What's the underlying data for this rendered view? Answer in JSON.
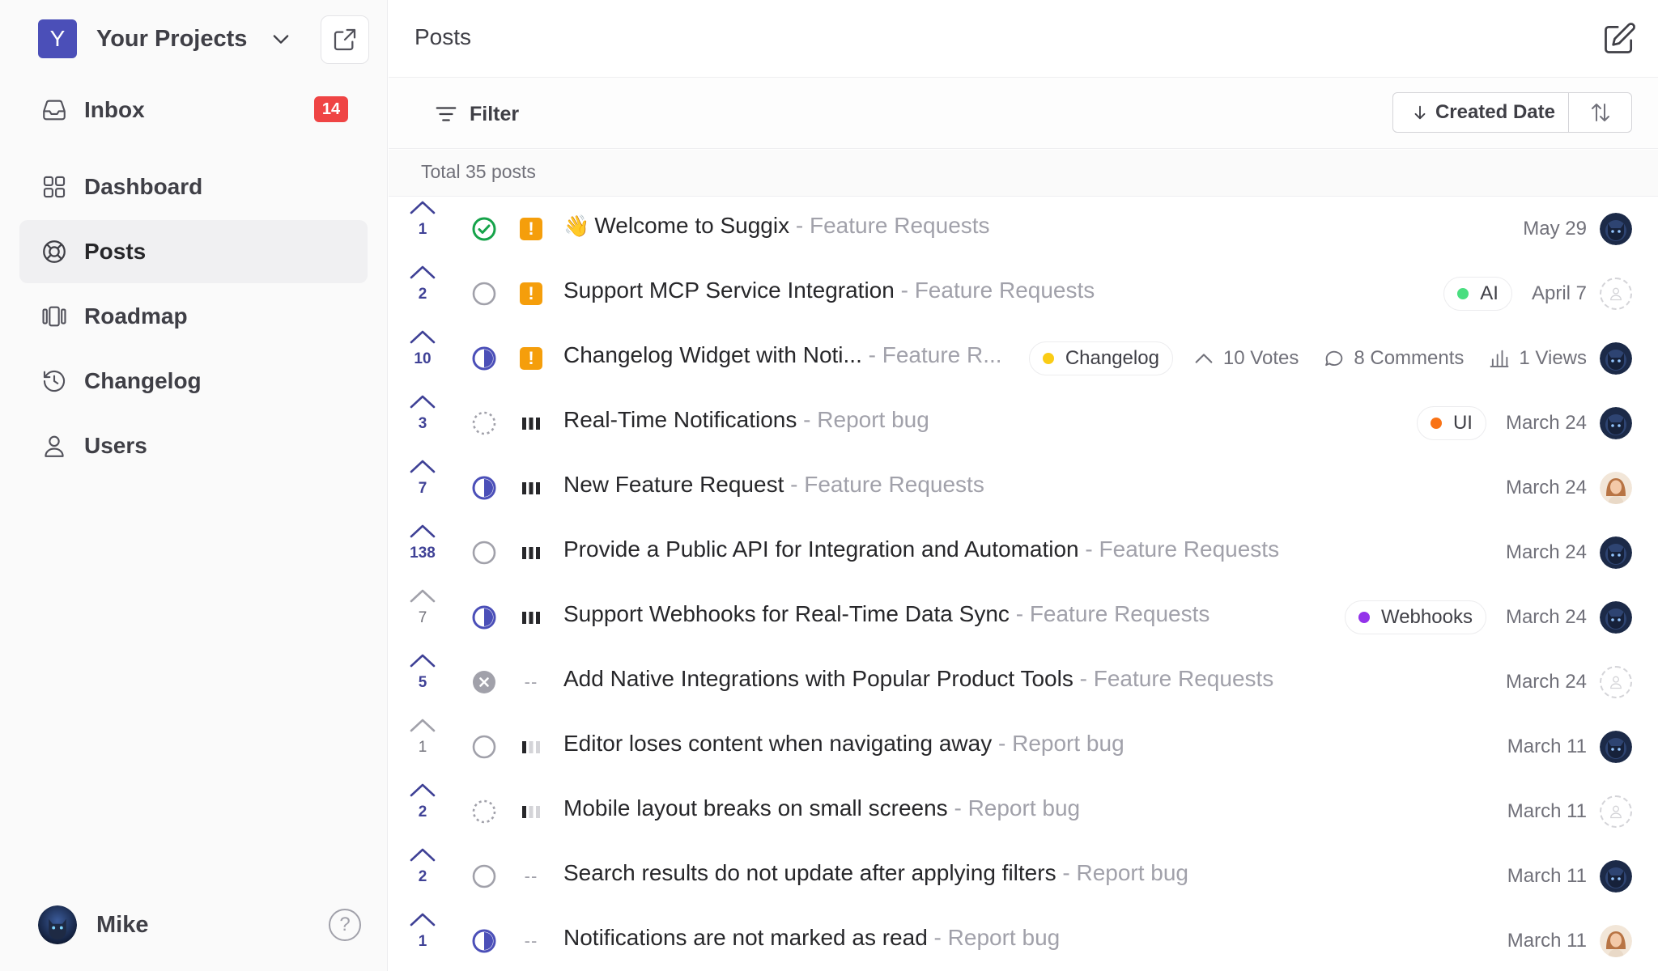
{
  "colors": {
    "brand": "#4b4fb8",
    "vote_active": "#3f4196",
    "badge": "#ef4444",
    "urgent": "#f59e0b",
    "done": "#16a34a"
  },
  "project": {
    "initial": "Y",
    "name": "Your Projects"
  },
  "nav": [
    {
      "label": "Inbox",
      "icon": "inbox-icon",
      "badge": "14"
    },
    {
      "label": "Dashboard",
      "icon": "dashboard-icon"
    },
    {
      "label": "Posts",
      "icon": "posts-icon",
      "active": true
    },
    {
      "label": "Roadmap",
      "icon": "roadmap-icon"
    },
    {
      "label": "Changelog",
      "icon": "changelog-icon"
    },
    {
      "label": "Users",
      "icon": "users-icon"
    }
  ],
  "user": {
    "name": "Mike",
    "help": "?"
  },
  "header": {
    "title": "Posts"
  },
  "toolbar": {
    "filter_label": "Filter",
    "sort_label": "Created Date"
  },
  "list": {
    "total": "Total 35 posts"
  },
  "posts": [
    {
      "votes": "1",
      "voted": true,
      "status": "complete",
      "priority": "urgent",
      "emoji": "👋",
      "title": "Welcome to Suggix",
      "board": "Feature Requests",
      "tags": [],
      "date": "May 29",
      "assignee": "cat-avatar"
    },
    {
      "votes": "2",
      "voted": true,
      "status": "open",
      "priority": "urgent",
      "title": "Support MCP Service Integration",
      "board": "Feature Requests",
      "tags": [
        {
          "name": "AI",
          "color": "#4ade80"
        }
      ],
      "date": "April 7",
      "assignee": "unassigned"
    },
    {
      "votes": "10",
      "voted": true,
      "status": "in-progress",
      "priority": "urgent",
      "title": "Changelog Widget with Noti...",
      "board": "Feature R...",
      "tags": [
        {
          "name": "Changelog",
          "color": "#facc15"
        }
      ],
      "stats": {
        "votes": "10 Votes",
        "comments": "8 Comments",
        "views": "1 Views"
      },
      "date": "",
      "assignee": "cat-avatar"
    },
    {
      "votes": "3",
      "voted": true,
      "status": "planned",
      "priority": "high",
      "title": "Real-Time Notifications",
      "board": "Report bug",
      "tags": [
        {
          "name": "UI",
          "color": "#f97316"
        }
      ],
      "date": "March 24",
      "assignee": "cat-avatar"
    },
    {
      "votes": "7",
      "voted": true,
      "status": "in-progress",
      "priority": "high",
      "title": "New Feature Request",
      "board": "Feature Requests",
      "tags": [],
      "date": "March 24",
      "assignee": "woman-avatar"
    },
    {
      "votes": "138",
      "voted": true,
      "status": "open",
      "priority": "high",
      "title": "Provide a Public API for Integration and Automation",
      "board": "Feature Requests",
      "tags": [],
      "date": "March 24",
      "assignee": "cat-avatar"
    },
    {
      "votes": "7",
      "voted": false,
      "status": "in-progress",
      "priority": "high",
      "title": "Support Webhooks for Real-Time Data Sync",
      "board": "Feature Requests",
      "tags": [
        {
          "name": "Webhooks",
          "color": "#9333ea"
        }
      ],
      "date": "March 24",
      "assignee": "cat-avatar"
    },
    {
      "votes": "5",
      "voted": true,
      "status": "closed",
      "priority": "none",
      "title": "Add Native Integrations with Popular Product Tools",
      "board": "Feature Requests",
      "tags": [],
      "date": "March 24",
      "assignee": "unassigned"
    },
    {
      "votes": "1",
      "voted": false,
      "status": "open",
      "priority": "low",
      "title": "Editor loses content when navigating away",
      "board": "Report bug",
      "tags": [],
      "date": "March 11",
      "assignee": "cat-avatar"
    },
    {
      "votes": "2",
      "voted": true,
      "status": "planned",
      "priority": "low",
      "title": "Mobile layout breaks on small screens",
      "board": "Report bug",
      "tags": [],
      "date": "March 11",
      "assignee": "unassigned"
    },
    {
      "votes": "2",
      "voted": true,
      "status": "open",
      "priority": "none",
      "title": "Search results do not update after applying filters",
      "board": "Report bug",
      "tags": [],
      "date": "March 11",
      "assignee": "cat-avatar"
    },
    {
      "votes": "1",
      "voted": true,
      "status": "in-progress",
      "priority": "none",
      "title": "Notifications are not marked as read",
      "board": "Report bug",
      "tags": [],
      "date": "March 11",
      "assignee": "woman-avatar"
    }
  ]
}
